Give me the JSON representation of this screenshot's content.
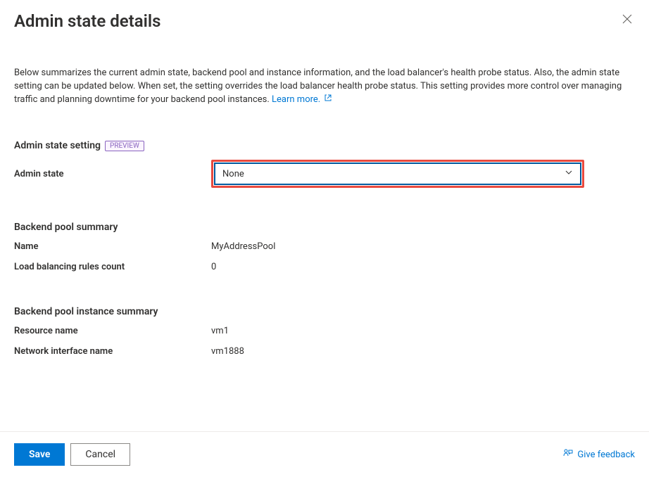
{
  "header": {
    "title": "Admin state details"
  },
  "description": {
    "text": "Below summarizes the current admin state, backend pool and instance information, and the load balancer's health probe status. Also, the admin state setting can be updated below. When set, the setting overrides the load balancer health probe status. This setting provides more control over managing traffic and planning downtime for your backend pool instances. ",
    "learn_more": "Learn more."
  },
  "admin_state_setting": {
    "heading": "Admin state setting",
    "badge": "PREVIEW",
    "label": "Admin state",
    "dropdown_value": "None"
  },
  "backend_pool_summary": {
    "heading": "Backend pool summary",
    "name_label": "Name",
    "name_value": "MyAddressPool",
    "rules_label": "Load balancing rules count",
    "rules_value": "0"
  },
  "backend_instance_summary": {
    "heading": "Backend pool instance summary",
    "resource_label": "Resource name",
    "resource_value": "vm1",
    "nic_label": "Network interface name",
    "nic_value": "vm1888"
  },
  "footer": {
    "save": "Save",
    "cancel": "Cancel",
    "feedback": "Give feedback"
  }
}
